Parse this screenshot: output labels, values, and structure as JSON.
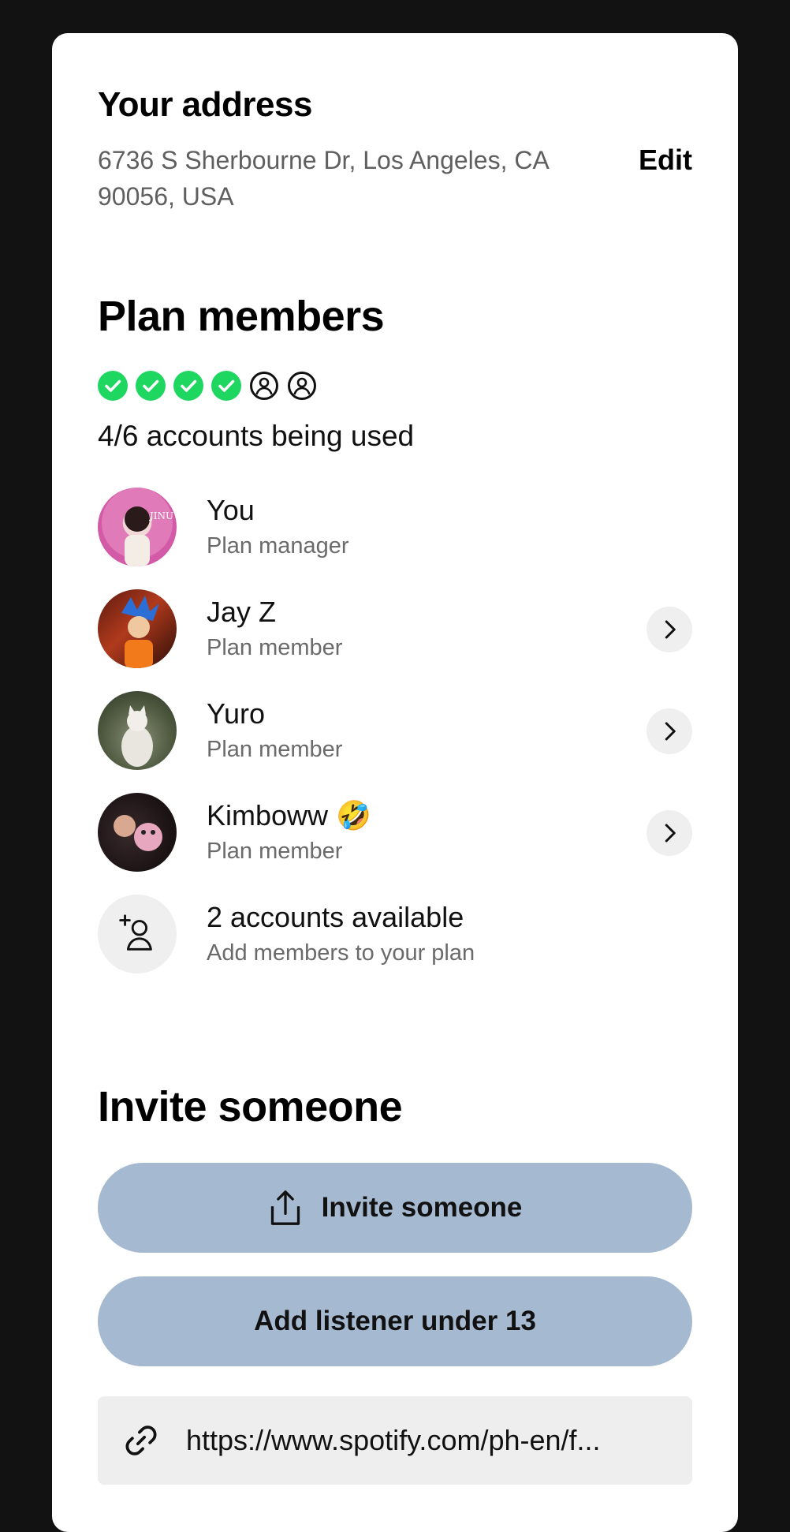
{
  "address": {
    "title": "Your address",
    "text": "6736 S Sherbourne Dr, Los Angeles, CA 90056, USA",
    "edit_label": "Edit"
  },
  "plan": {
    "title": "Plan members",
    "slots": [
      "filled",
      "filled",
      "filled",
      "filled",
      "empty",
      "empty"
    ],
    "usage_text": "4/6 accounts being used",
    "members": [
      {
        "name": "You",
        "role": "Plan manager",
        "has_chevron": false
      },
      {
        "name": "Jay Z",
        "role": "Plan member",
        "has_chevron": true
      },
      {
        "name": "Yuro",
        "role": "Plan member",
        "has_chevron": true
      },
      {
        "name": "Kimboww 🤣",
        "role": "Plan member",
        "has_chevron": true
      }
    ],
    "available": {
      "title": "2 accounts available",
      "subtitle": "Add members to your plan"
    }
  },
  "invite": {
    "title": "Invite someone",
    "invite_button": "Invite someone",
    "under13_button": "Add listener under 13",
    "link_text": "https://www.spotify.com/ph-en/f..."
  },
  "colors": {
    "accent_green": "#1ed760",
    "button_blue": "#a5b9d0",
    "background": "#121212"
  },
  "icons": {
    "slot_filled": "check-circle-icon",
    "slot_empty": "user-circle-icon",
    "add_member": "add-user-icon",
    "chevron": "chevron-right-icon",
    "share": "share-icon",
    "link": "link-icon"
  }
}
